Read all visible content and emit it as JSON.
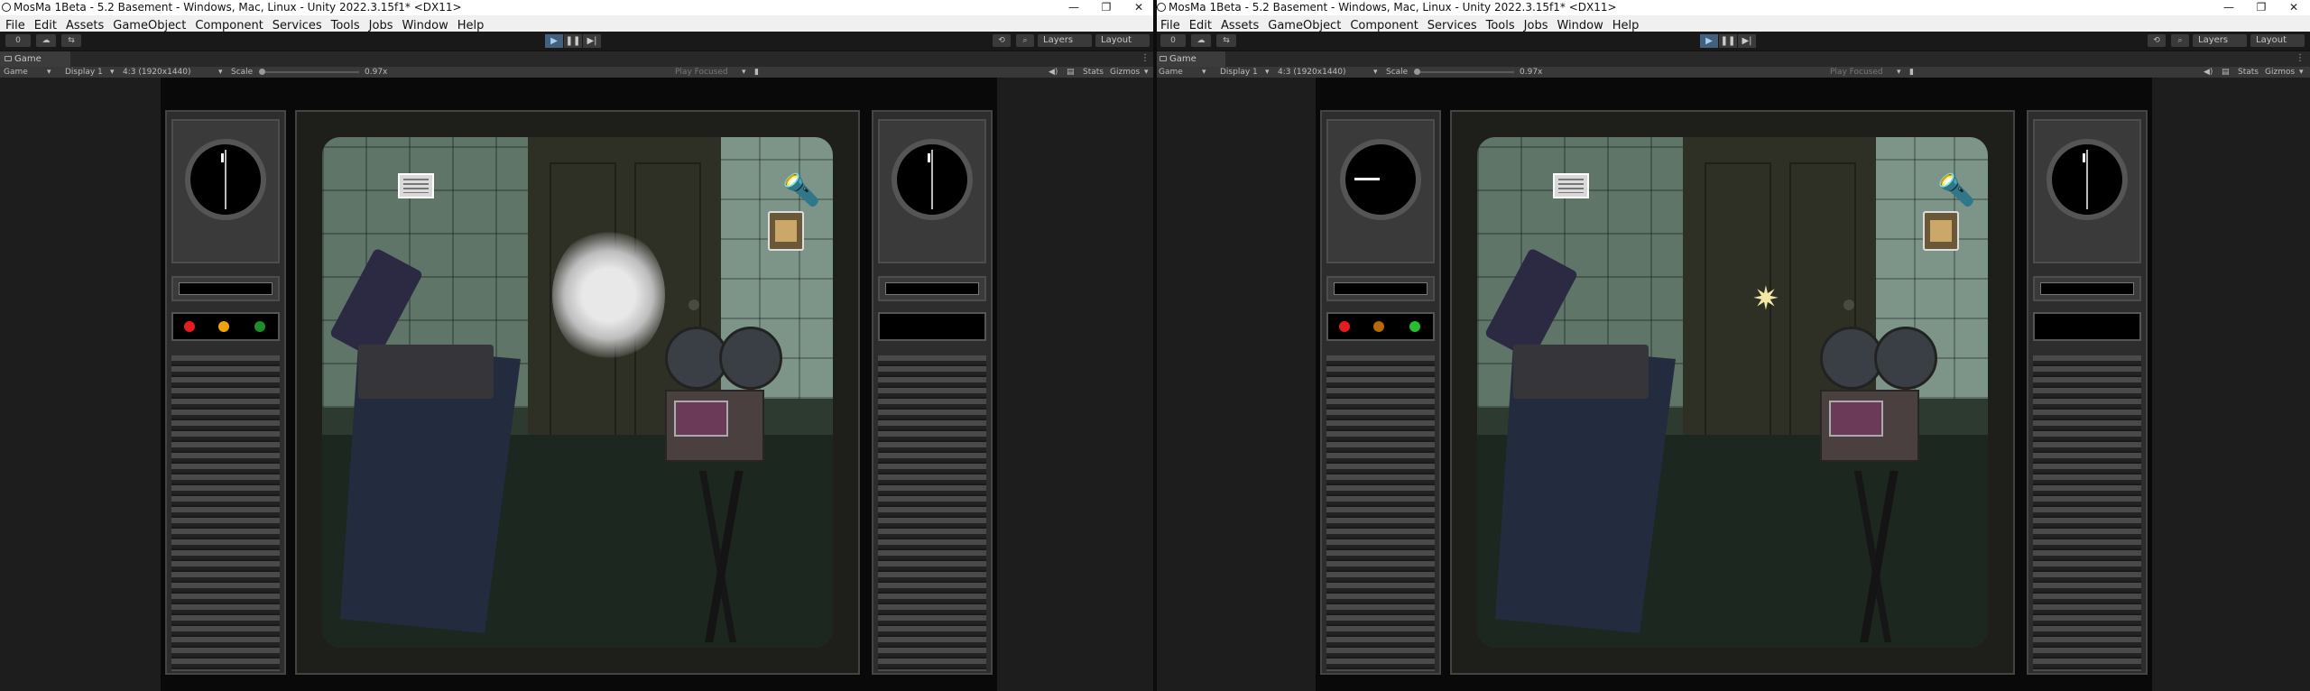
{
  "window": {
    "title": "MosMa 1Beta - 5.2 Basement - Windows, Mac, Linux - Unity 2022.3.15f1* <DX11>",
    "minimize": "—",
    "restore": "❐",
    "close": "✕"
  },
  "menu": [
    "File",
    "Edit",
    "Assets",
    "GameObject",
    "Component",
    "Services",
    "Tools",
    "Jobs",
    "Window",
    "Help"
  ],
  "toolbar": {
    "account": "0",
    "layers": "Layers",
    "layout": "Layout",
    "play": "▶",
    "pause": "❚❚",
    "step": "▶|"
  },
  "tab": {
    "label": "Game",
    "menu": "⋮"
  },
  "game_bar": {
    "mode": "Game",
    "display": "Display 1",
    "aspect": "4:3 (1920x1440)",
    "scale_label": "Scale",
    "scale_value": "0.97x",
    "play_focused": "Play Focused",
    "stats": "Stats",
    "gizmos": "Gizmos"
  },
  "indicator_colors": {
    "left": [
      "#e21e1e",
      "#f2a20c",
      "#1e8e2c"
    ],
    "right": [
      "#e21e1e",
      "#b86a0a",
      "#28c02e"
    ]
  },
  "icons": {
    "unity": "unity-icon",
    "play": "play-icon",
    "pause": "pause-icon",
    "step": "step-icon",
    "flashlight": "flashlight-icon",
    "canister": "film-canister-icon",
    "box": "tape-box-icon",
    "smoke": "smoke-effect",
    "sparkle": "sparkle-effect"
  }
}
